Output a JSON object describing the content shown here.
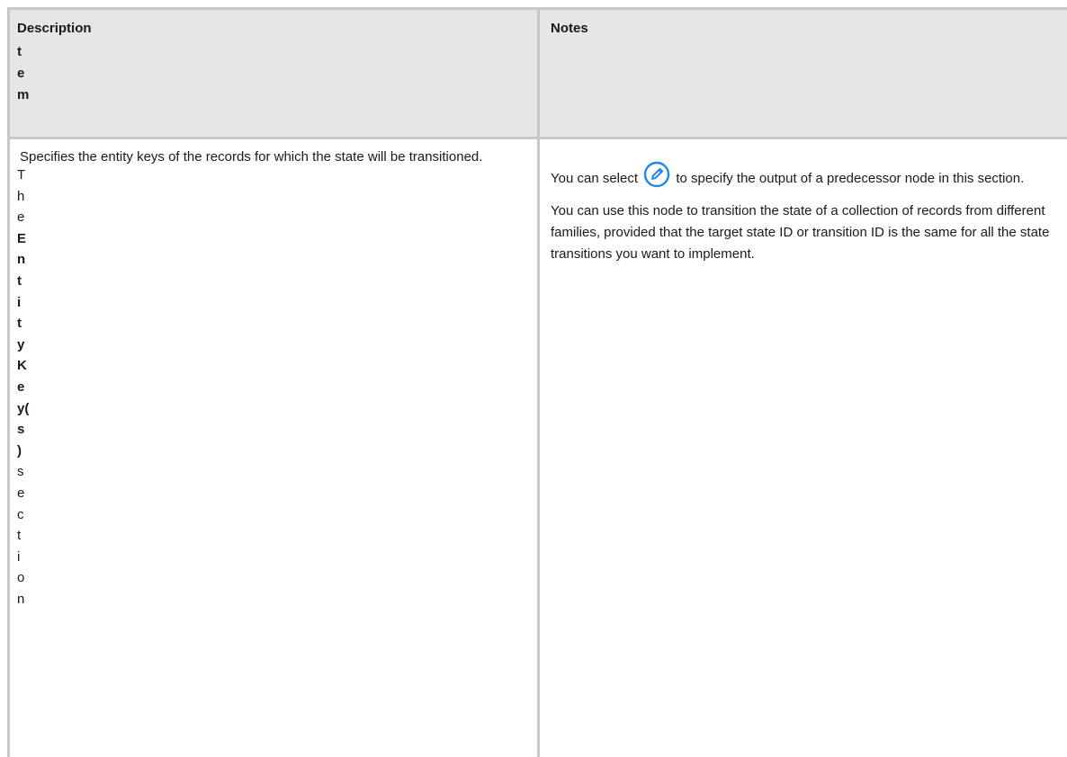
{
  "header": {
    "item_letters": [
      "t",
      "e",
      "m"
    ],
    "description": "Description",
    "notes": "Notes"
  },
  "row": {
    "item_letters": [
      {
        "c": "T",
        "b": false
      },
      {
        "c": "h",
        "b": false
      },
      {
        "c": "e",
        "b": false
      },
      {
        "c": "E",
        "b": true
      },
      {
        "c": "n",
        "b": true
      },
      {
        "c": "t",
        "b": true
      },
      {
        "c": "i",
        "b": true
      },
      {
        "c": "t",
        "b": true
      },
      {
        "c": "y",
        "b": true
      },
      {
        "c": "K",
        "b": true
      },
      {
        "c": "e",
        "b": true
      },
      {
        "c": "y(",
        "b": true
      },
      {
        "c": "s",
        "b": true
      },
      {
        "c": ")",
        "b": true
      },
      {
        "c": "s",
        "b": false
      },
      {
        "c": "e",
        "b": false
      },
      {
        "c": "c",
        "b": false
      },
      {
        "c": "t",
        "b": false
      },
      {
        "c": "i",
        "b": false
      },
      {
        "c": "o",
        "b": false
      },
      {
        "c": "n",
        "b": false
      }
    ],
    "description": "Specifies the entity keys of the records for which the state will be transitioned.",
    "notes_p1_before": "You can select",
    "notes_p1_after": "to specify the output of a predecessor node in this section.",
    "notes_p2": "You can use this node to transition the state of a collection of records from different families, provided that the target state ID or transition ID is the same for all the state transitions you want to implement.",
    "icon": "edit-pencil-icon",
    "icon_color": "#1e88e5"
  }
}
